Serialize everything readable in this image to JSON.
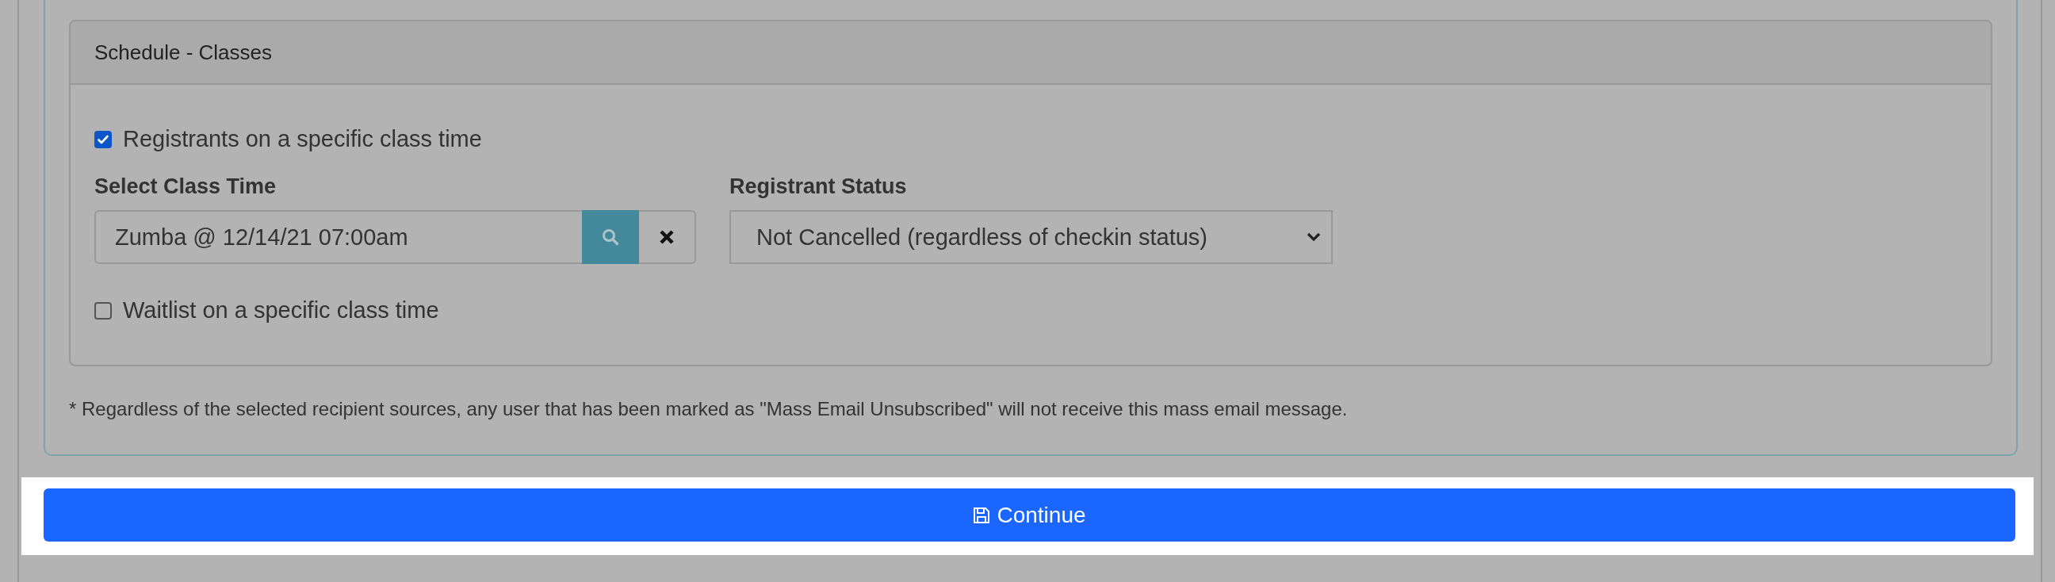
{
  "card": {
    "title": "Schedule - Classes"
  },
  "registrants_option": {
    "label": "Registrants on a specific class time",
    "checked": true
  },
  "class_time": {
    "label": "Select Class Time",
    "value": "Zumba @ 12/14/21 07:00am"
  },
  "registrant_status": {
    "label": "Registrant Status",
    "value": "Not Cancelled (regardless of checkin status)"
  },
  "waitlist_option": {
    "label": "Waitlist on a specific class time",
    "checked": false
  },
  "footnote": "* Regardless of the selected recipient sources, any user that has been marked as \"Mass Email Unsubscribed\" will not receive this mass email message.",
  "continue_button": {
    "label": "Continue"
  }
}
